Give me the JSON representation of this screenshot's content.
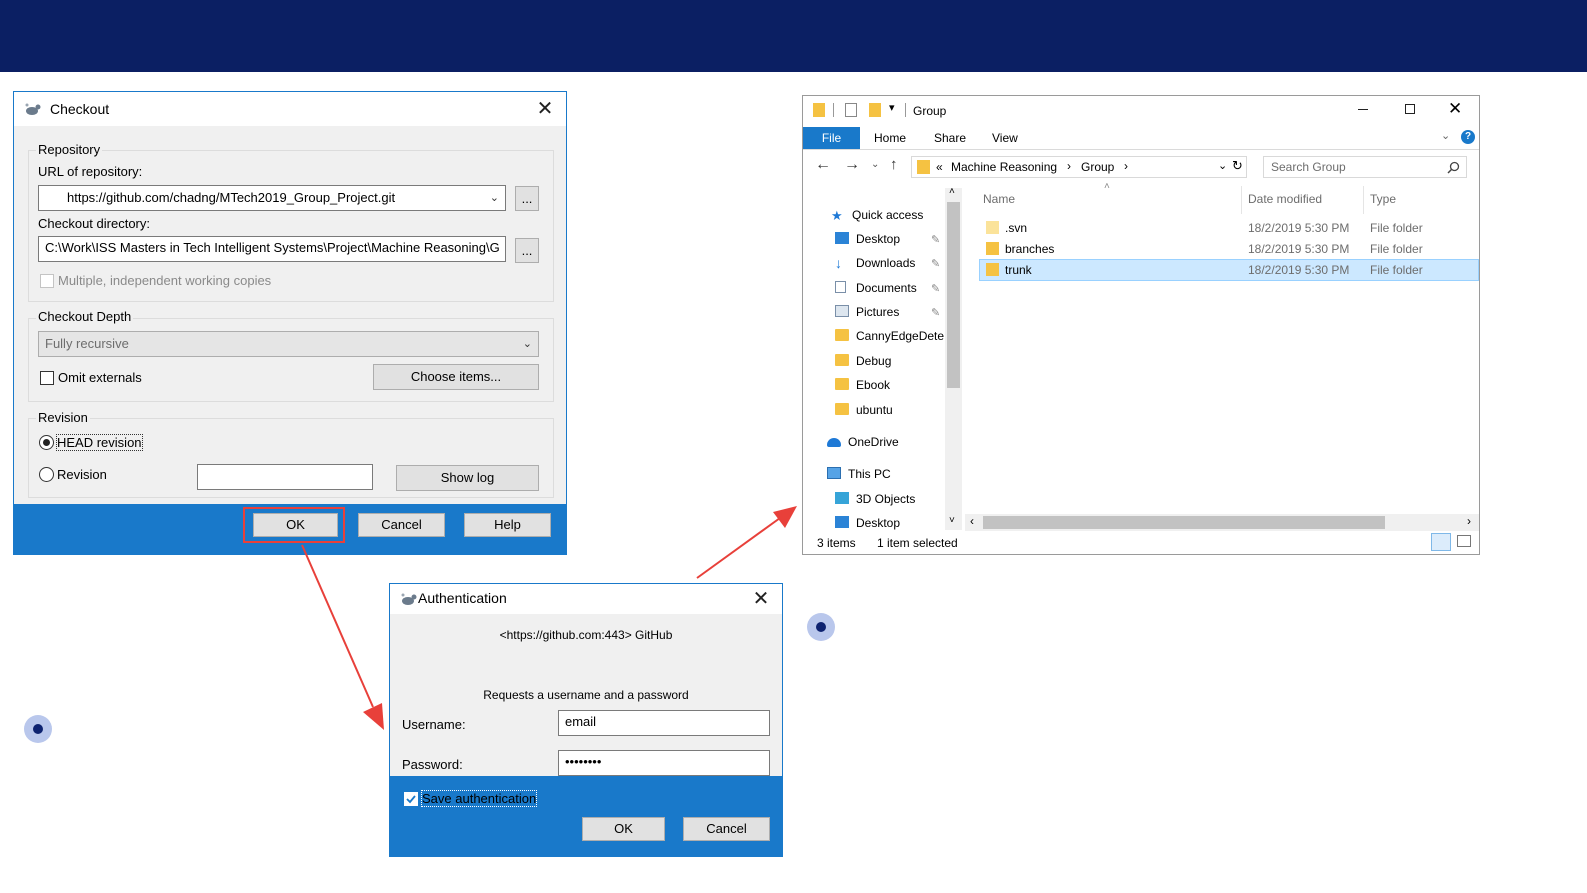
{
  "checkout": {
    "title": "Checkout",
    "repository_group": "Repository",
    "url_label": "URL of repository:",
    "url_value": "https://github.com/chadng/MTech2019_Group_Project.git",
    "dir_label": "Checkout directory:",
    "dir_value": "C:\\Work\\ISS Masters in Tech Intelligent Systems\\Project\\Machine Reasoning\\G",
    "browse_label": "...",
    "multiple_label": "Multiple, independent working copies",
    "depth_group": "Checkout Depth",
    "depth_value": "Fully recursive",
    "omit_externals": "Omit externals",
    "choose_items": "Choose items...",
    "revision_group": "Revision",
    "head_revision": "HEAD revision",
    "revision_label": "Revision",
    "revision_value": "",
    "show_log": "Show log",
    "ok": "OK",
    "cancel": "Cancel",
    "help": "Help"
  },
  "auth": {
    "title": "Authentication",
    "realm": "<https://github.com:443> GitHub",
    "request": "Requests a username and a password",
    "username_label": "Username:",
    "username_value": "email",
    "password_label": "Password:",
    "password_value": "••••••••",
    "save_auth": "Save authentication",
    "ok": "OK",
    "cancel": "Cancel"
  },
  "explorer": {
    "title": "Group",
    "tabs": [
      "File",
      "Home",
      "Share",
      "View"
    ],
    "breadcrumb": [
      "«",
      "Machine Reasoning",
      "Group"
    ],
    "search_placeholder": "Search Group",
    "nav": [
      {
        "label": "Quick access",
        "icon": "star-icon"
      },
      {
        "label": "Desktop",
        "icon": "desktop-icon"
      },
      {
        "label": "Downloads",
        "icon": "download-icon"
      },
      {
        "label": "Documents",
        "icon": "documents-icon"
      },
      {
        "label": "Pictures",
        "icon": "pictures-icon"
      },
      {
        "label": "CannyEdgeDete",
        "icon": "folder-icon"
      },
      {
        "label": "Debug",
        "icon": "folder-icon"
      },
      {
        "label": "Ebook",
        "icon": "folder-icon"
      },
      {
        "label": "ubuntu",
        "icon": "folder-icon"
      },
      {
        "label": "OneDrive",
        "icon": "cloud-icon"
      },
      {
        "label": "This PC",
        "icon": "computer-icon"
      },
      {
        "label": "3D Objects",
        "icon": "cube-icon"
      },
      {
        "label": "Desktop",
        "icon": "desktop-icon"
      }
    ],
    "columns": [
      "Name",
      "Date modified",
      "Type"
    ],
    "files": [
      {
        "name": ".svn",
        "date": "18/2/2019 5:30 PM",
        "type": "File folder"
      },
      {
        "name": "branches",
        "date": "18/2/2019 5:30 PM",
        "type": "File folder"
      },
      {
        "name": "trunk",
        "date": "18/2/2019 5:30 PM",
        "type": "File folder"
      }
    ],
    "status_items": "3 items",
    "status_selected": "1 item selected"
  },
  "colors": {
    "banner": "#0b1f63",
    "accent": "#1979ca",
    "arrow": "#e8403a",
    "selection": "#cce8ff"
  }
}
